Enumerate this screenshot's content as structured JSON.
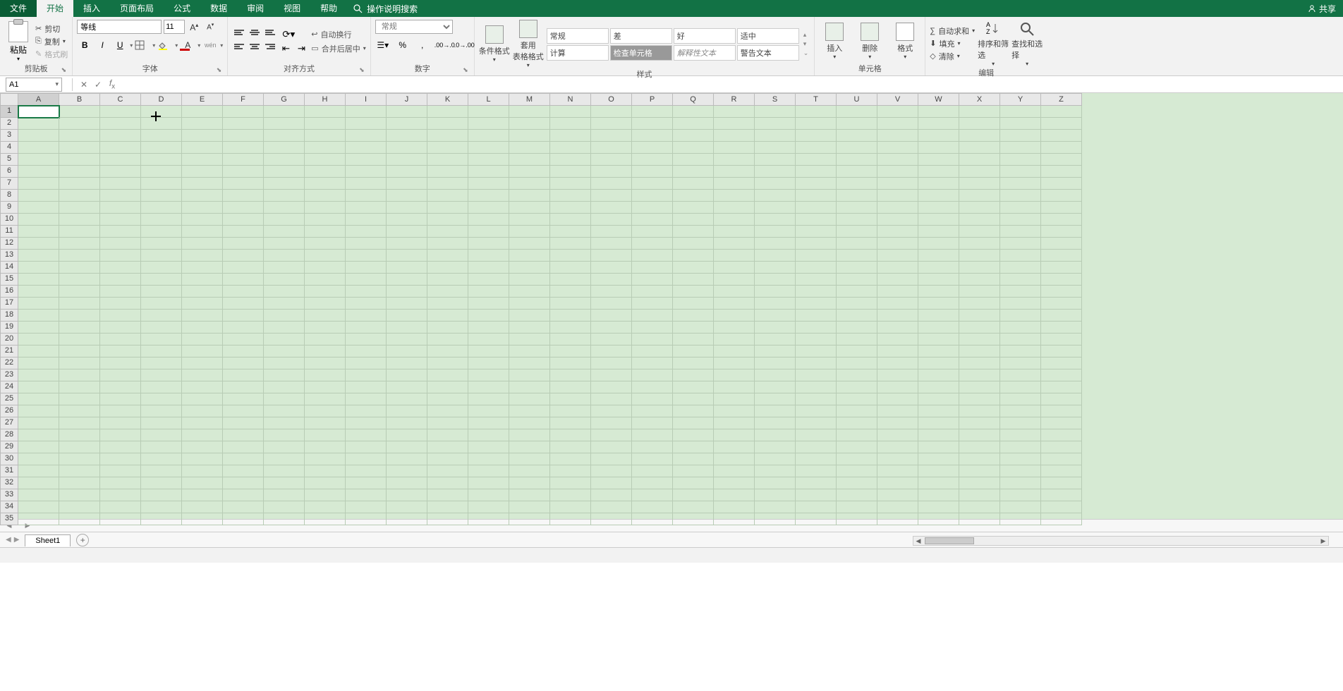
{
  "menu": {
    "file": "文件",
    "tabs": [
      "开始",
      "插入",
      "页面布局",
      "公式",
      "数据",
      "审阅",
      "视图",
      "帮助"
    ],
    "active_index": 0,
    "search": "操作说明搜索",
    "share": "共享"
  },
  "ribbon": {
    "clipboard": {
      "paste": "粘贴",
      "cut": "剪切",
      "copy": "复制",
      "format_painter": "格式刷",
      "label": "剪贴板"
    },
    "font": {
      "name": "等线",
      "size": "11",
      "label": "字体"
    },
    "alignment": {
      "wrap": "自动换行",
      "merge": "合并后居中",
      "label": "对齐方式"
    },
    "number": {
      "format": "常规",
      "label": "数字"
    },
    "styles": {
      "cond": "条件格式",
      "table": "套用\n表格格式",
      "cells": [
        "常规",
        "差",
        "好",
        "适中",
        "计算",
        "检查单元格",
        "解释性文本",
        "警告文本"
      ],
      "label": "样式"
    },
    "cells_group": {
      "insert": "插入",
      "delete": "删除",
      "format": "格式",
      "label": "单元格"
    },
    "editing": {
      "autosum": "自动求和",
      "fill": "填充",
      "clear": "清除",
      "sort": "排序和筛选",
      "find": "查找和选择",
      "label": "编辑"
    }
  },
  "formula": {
    "name_box": "A1",
    "value": ""
  },
  "grid": {
    "columns": [
      "A",
      "B",
      "C",
      "D",
      "E",
      "F",
      "G",
      "H",
      "I",
      "J",
      "K",
      "L",
      "M",
      "N",
      "O",
      "P",
      "Q",
      "R",
      "S",
      "T",
      "U",
      "V",
      "W",
      "X",
      "Y",
      "Z"
    ],
    "rows": 35,
    "active_col": 0,
    "active_row": 0
  },
  "sheets": {
    "active": "Sheet1"
  }
}
